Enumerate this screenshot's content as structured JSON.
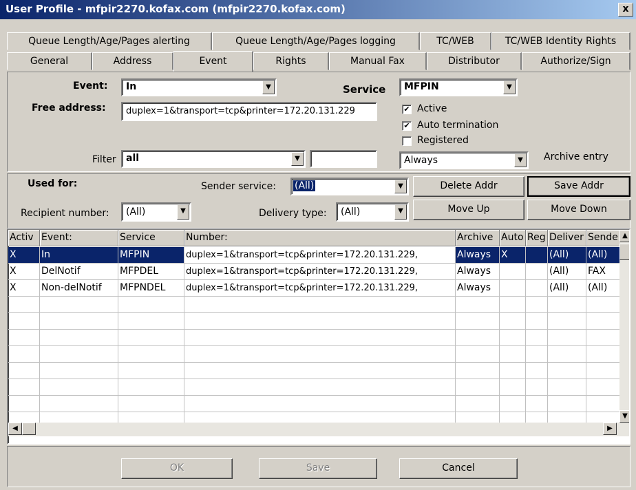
{
  "window": {
    "title": "User Profile - mfpir2270.kofax.com (mfpir2270.kofax.com)",
    "close": "x"
  },
  "tabs_row1": [
    "Queue Length/Age/Pages alerting",
    "Queue Length/Age/Pages logging",
    "TC/WEB",
    "TC/WEB Identity Rights"
  ],
  "tabs_row2": [
    "General",
    "Address",
    "Event",
    "Rights",
    "Manual Fax",
    "Distributor",
    "Authorize/Sign"
  ],
  "form": {
    "event_label": "Event:",
    "event_value": "In",
    "service_label": "Service",
    "service_value": "MFPIN",
    "free_address_label": "Free address:",
    "free_address_value": "duplex=1&transport=tcp&printer=172.20.131.229",
    "active_label": "Active",
    "auto_term_label": "Auto termination",
    "registered_label": "Registered",
    "check_mark": "✔",
    "filter_label": "Filter",
    "filter_value": "all",
    "filter_extra": "",
    "archive_value": "Always",
    "archive_label": "Archive entry"
  },
  "usedfor": {
    "label": "Used for:",
    "sender_service_label": "Sender service:",
    "sender_service_value": "(All)",
    "recipient_label": "Recipient number:",
    "recipient_value": "(All)",
    "delivery_label": "Delivery type:",
    "delivery_value": "(All)",
    "delete_btn": "Delete Addr",
    "save_addr_btn": "Save Addr",
    "move_up_btn": "Move Up",
    "move_down_btn": "Move Down"
  },
  "grid": {
    "headers": [
      "Activ",
      "Event:",
      "Service",
      "Number:",
      "Archive",
      "Auto",
      "Reg",
      "Deliver",
      "Sende"
    ],
    "rows": [
      [
        "X",
        "In",
        "MFPIN",
        "duplex=1&transport=tcp&printer=172.20.131.229,",
        "Always",
        "X",
        "",
        "(All)",
        "(All)"
      ],
      [
        "X",
        "DelNotif",
        "MFPDEL",
        "duplex=1&transport=tcp&printer=172.20.131.229,",
        "Always",
        "",
        "",
        "(All)",
        "FAX"
      ],
      [
        "X",
        "Non-delNotif",
        "MFPNDEL",
        "duplex=1&transport=tcp&printer=172.20.131.229,",
        "Always",
        "",
        "",
        "(All)",
        "(All)"
      ]
    ]
  },
  "icons": {
    "dropdown": "▼",
    "up": "▲",
    "down": "▼",
    "left": "◀",
    "right": "▶"
  },
  "footer": {
    "ok": "OK",
    "save": "Save",
    "cancel": "Cancel"
  }
}
